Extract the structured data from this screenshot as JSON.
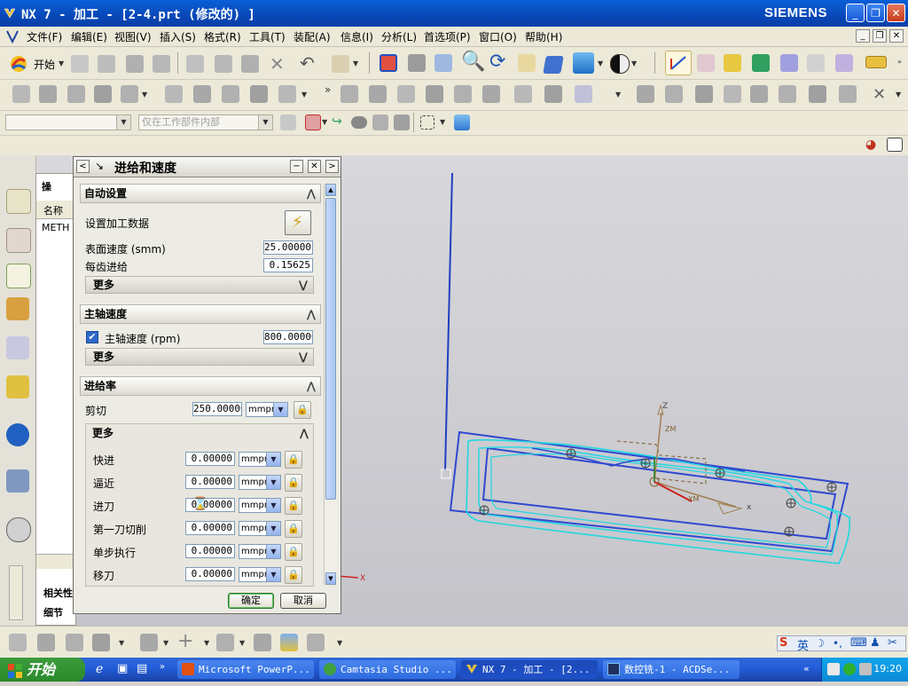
{
  "window": {
    "title": "NX 7 - 加工 - [2-4.prt  (修改的) ]",
    "brand": "SIEMENS",
    "controls": {
      "minimize": "_",
      "maximize": "❐",
      "close": "✕"
    }
  },
  "menubar": {
    "items": [
      "文件(F)",
      "编辑(E)",
      "视图(V)",
      "插入(S)",
      "格式(R)",
      "工具(T)",
      "装配(A)",
      "信息(I)",
      "分析(L)",
      "首选项(P)",
      "窗口(O)",
      "帮助(H)"
    ]
  },
  "toolbar": {
    "start_label": "开始",
    "filter_placeholder": "",
    "scope_value": "仅在工作部件内部"
  },
  "navigator": {
    "header_label": "操",
    "column_name": "名称",
    "root_item": "METH",
    "bottom_tab_related": "相关性",
    "bottom_tab_details": "细节"
  },
  "dialog": {
    "title": "进给和速度",
    "sections": {
      "auto": {
        "title": "自动设置",
        "set_data_label": "设置加工数据",
        "surface_speed_label": "表面速度 (smm)",
        "surface_speed_value": "25.00000",
        "feed_per_tooth_label": "每齿进给",
        "feed_per_tooth_value": "0.15625",
        "more_label": "更多"
      },
      "spindle": {
        "title": "主轴速度",
        "spindle_label": "主轴速度 (rpm)",
        "spindle_value": "800.00000",
        "more_label": "更多"
      },
      "feed": {
        "title": "进给率",
        "cut_label": "剪切",
        "cut_value": "250.00000",
        "cut_unit": "mmpm",
        "more_label": "更多",
        "rows": [
          {
            "label": "快进",
            "value": "0.00000",
            "unit": "mmpm"
          },
          {
            "label": "逼近",
            "value": "0.00000",
            "unit": "mmpm"
          },
          {
            "label": "进刀",
            "value": "0.00000",
            "unit": "mmpm"
          },
          {
            "label": "第一刀切削",
            "value": "0.00000",
            "unit": "mmpm"
          },
          {
            "label": "单步执行",
            "value": "0.00000",
            "unit": "mmpm"
          },
          {
            "label": "移刀",
            "value": "0.00000",
            "unit": "mmpm"
          }
        ]
      }
    },
    "ok_label": "确定",
    "cancel_label": "取消"
  },
  "viewport": {
    "axis_z": "Z",
    "axis_x": "X",
    "axis_xm": "XM",
    "axis_zm": "ZM",
    "axis_x_small": "x",
    "wcs_x": "X"
  },
  "taskbar": {
    "start_label": "开始",
    "tasks": [
      {
        "label": "Microsoft PowerP...",
        "icon": "powerpoint-icon",
        "active": false
      },
      {
        "label": "Camtasia Studio ...",
        "icon": "camtasia-icon",
        "active": false
      },
      {
        "label": "NX 7 - 加工 - [2...",
        "icon": "nx-icon",
        "active": true
      },
      {
        "label": "数控铣-1 - ACDSe...",
        "icon": "acdsee-icon",
        "active": false
      }
    ],
    "clock": "19:20"
  },
  "colors": {
    "title_blue": "#0848b8",
    "model_blue": "#3048d0",
    "model_cyan": "#20d8e0",
    "taskbar_blue": "#245edb"
  }
}
